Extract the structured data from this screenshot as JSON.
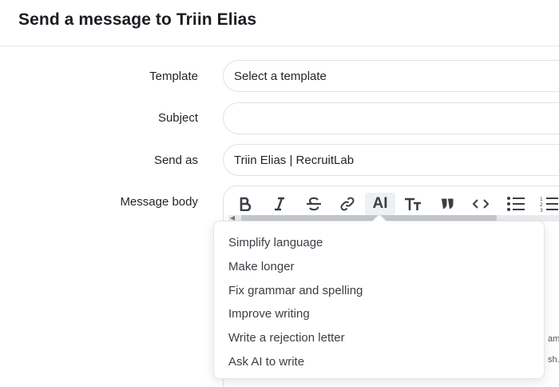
{
  "dialog": {
    "title": "Send a message to Triin Elias"
  },
  "form": {
    "template_label": "Template",
    "template_value": "Select a template",
    "subject_label": "Subject",
    "subject_value": "",
    "send_as_label": "Send as",
    "send_as_value": "Triin Elias | RecruitLab",
    "body_label": "Message body"
  },
  "toolbar": {
    "items": [
      {
        "name": "bold",
        "icon": "bold-icon"
      },
      {
        "name": "italic",
        "icon": "italic-icon"
      },
      {
        "name": "strikethrough",
        "icon": "strikethrough-icon"
      },
      {
        "name": "link",
        "icon": "link-icon"
      },
      {
        "name": "ai",
        "label": "AI"
      },
      {
        "name": "heading",
        "icon": "heading-icon"
      },
      {
        "name": "quote",
        "icon": "quote-icon"
      },
      {
        "name": "code",
        "icon": "code-icon"
      },
      {
        "name": "bullet-list",
        "icon": "bullet-list-icon"
      },
      {
        "name": "numbered-list",
        "icon": "numbered-list-icon"
      }
    ]
  },
  "ai_menu": {
    "items": [
      "Simplify language",
      "Make longer",
      "Fix grammar and spelling",
      "Improve writing",
      "Write a rejection letter",
      "Ask AI to write"
    ]
  },
  "editor_behind": {
    "fragment1": "amd",
    "fragment2": "sh.c"
  }
}
